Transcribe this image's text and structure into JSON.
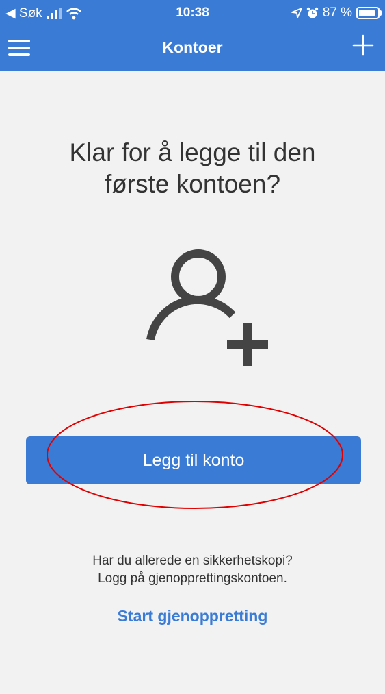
{
  "status_bar": {
    "back_label": "◀ Søk",
    "time": "10:38",
    "battery_percent": "87 %",
    "signal_icon": "cellular-signal-icon",
    "wifi_icon": "wifi-icon",
    "location_icon": "location-arrow-icon",
    "alarm_icon": "alarm-icon",
    "battery_level": 0.87
  },
  "navbar": {
    "title": "Kontoer",
    "menu_icon": "hamburger-menu-icon",
    "add_icon": "plus-icon"
  },
  "main": {
    "prompt_line1": "Klar for å legge til den",
    "prompt_line2": "første kontoen?",
    "illustration_icon": "user-add-icon",
    "add_account_button": "Legg til konto",
    "backup_line1": "Har du allerede en sikkerhetskopi?",
    "backup_line2": "Logg på gjenopprettingskontoen.",
    "restore_link": "Start gjenoppretting"
  },
  "colors": {
    "accent": "#3a7bd5",
    "background": "#f2f2f2",
    "text": "#333333",
    "annotation": "#e00000"
  }
}
